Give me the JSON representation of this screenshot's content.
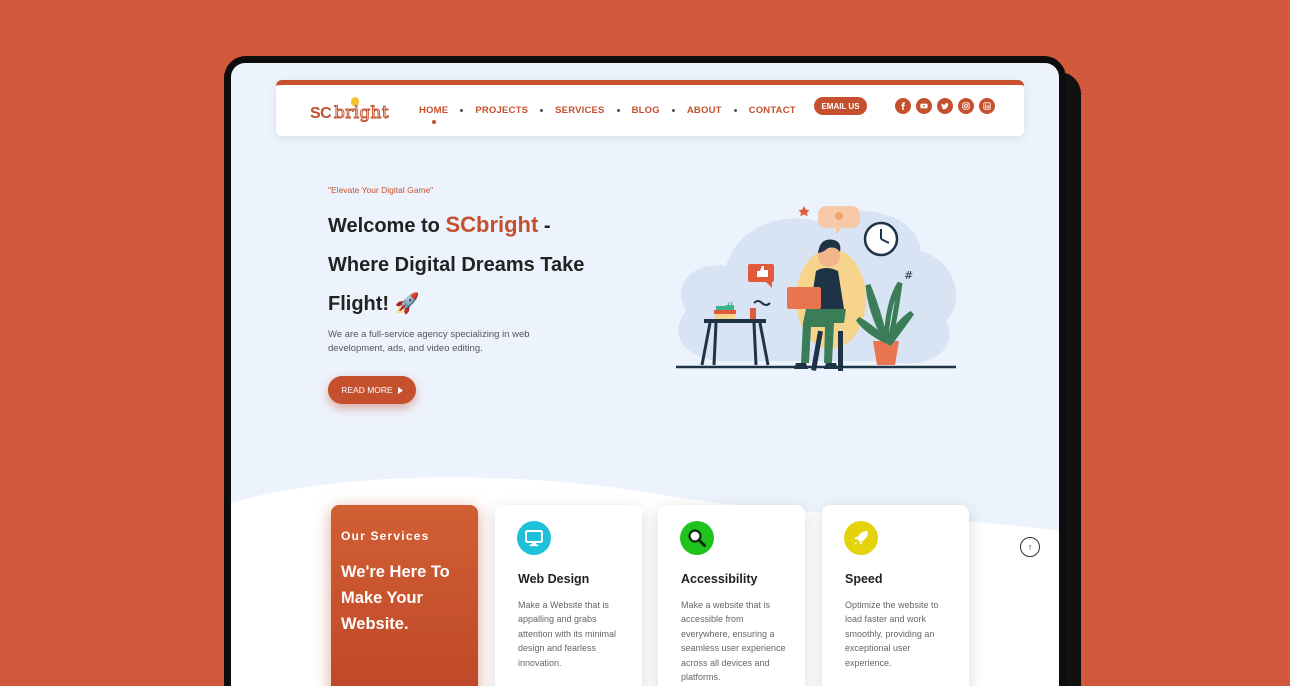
{
  "nav": {
    "logo": {
      "prefix": "SC",
      "suffix": "bright"
    },
    "items": [
      {
        "label": "HOME",
        "active": true
      },
      {
        "label": "PROJECTS",
        "active": false
      },
      {
        "label": "SERVICES",
        "active": false
      },
      {
        "label": "BLOG",
        "active": false
      },
      {
        "label": "ABOUT",
        "active": false
      },
      {
        "label": "CONTACT",
        "active": false
      }
    ],
    "email_label": "EMAIL US",
    "socials": [
      "facebook-icon",
      "youtube-icon",
      "twitter-icon",
      "instagram-icon",
      "linkedin-icon"
    ]
  },
  "hero": {
    "tagline": "\"Elevate Your Digital Game\"",
    "title_pre": "Welcome to",
    "brand": "SCbright",
    "title_post": " -",
    "title_line2": "Where Digital Dreams Take",
    "title_line3": "Flight! 🚀",
    "description": "We are a full-service agency specializing in web development, ads, and video editing.",
    "cta_label": "READ MORE"
  },
  "services": {
    "subheading": "Our Services",
    "heading": "We're Here To Make Your Website.",
    "cards": [
      {
        "icon": "monitor-icon",
        "title": "Web Design",
        "text": "Make a Website that is appalling and grabs attention with its minimal design and fearless innovation."
      },
      {
        "icon": "magnifier-icon",
        "title": "Accessibility",
        "text": "Make a website that is accessible from everywhere, ensuring a seamless user experience across all devices and platforms."
      },
      {
        "icon": "rocket-icon",
        "title": "Speed",
        "text": "Optimize the website to load faster and work smoothly, providing an exceptional user experience."
      }
    ]
  },
  "scroll_top_label": "↑",
  "colors": {
    "accent": "#c4502e",
    "background": "#d35a3c",
    "screen": "#edf3fd"
  }
}
